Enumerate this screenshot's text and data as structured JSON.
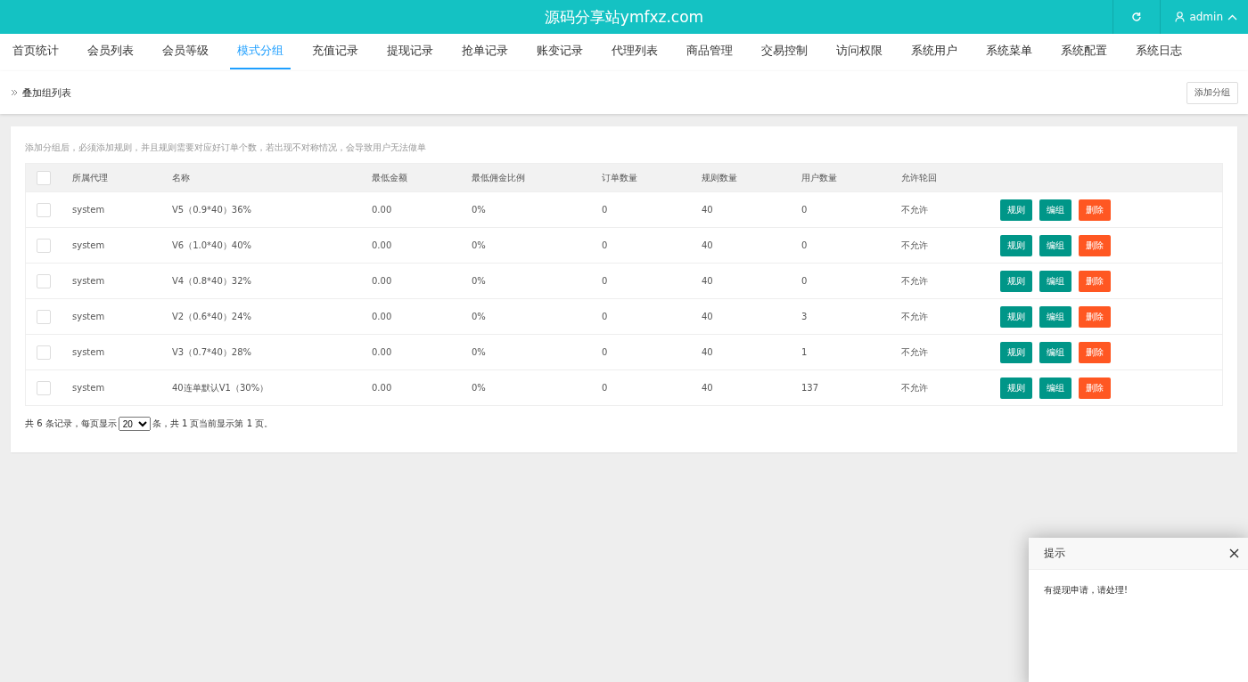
{
  "header": {
    "title": "源码分享站ymfxz.com",
    "user": "admin"
  },
  "tabs": [
    {
      "label": "首页统计",
      "selected": false
    },
    {
      "label": "会员列表",
      "selected": false
    },
    {
      "label": "会员等级",
      "selected": false
    },
    {
      "label": "模式分组",
      "selected": true
    },
    {
      "label": "充值记录",
      "selected": false
    },
    {
      "label": "提现记录",
      "selected": false
    },
    {
      "label": "抢单记录",
      "selected": false
    },
    {
      "label": "账变记录",
      "selected": false
    },
    {
      "label": "代理列表",
      "selected": false
    },
    {
      "label": "商品管理",
      "selected": false
    },
    {
      "label": "交易控制",
      "selected": false
    },
    {
      "label": "访问权限",
      "selected": false
    },
    {
      "label": "系统用户",
      "selected": false
    },
    {
      "label": "系统菜单",
      "selected": false
    },
    {
      "label": "系统配置",
      "selected": false
    },
    {
      "label": "系统日志",
      "selected": false
    }
  ],
  "breadcrumb": "叠加组列表",
  "add_button": "添加分组",
  "notice": "添加分组后，必须添加规则，并且规则需要对应好订单个数，若出现不对称情况，会导致用户无法做单",
  "table": {
    "select_all_checked": false,
    "columns": [
      "所属代理",
      "名称",
      "最低金额",
      "最低佣金比例",
      "订单数量",
      "规则数量",
      "用户数量",
      "允许轮回"
    ],
    "rows": [
      {
        "checked": false,
        "cells": [
          "system",
          "V5（0.9*40）36%",
          "0.00",
          "0%",
          "0",
          "40",
          "0",
          "不允许"
        ],
        "actions": [
          {
            "label": "规则",
            "kind": "primary"
          },
          {
            "label": "编组",
            "kind": "primary"
          },
          {
            "label": "删除",
            "kind": "danger"
          }
        ]
      },
      {
        "checked": false,
        "cells": [
          "system",
          "V6（1.0*40）40%",
          "0.00",
          "0%",
          "0",
          "40",
          "0",
          "不允许"
        ],
        "actions": [
          {
            "label": "规则",
            "kind": "primary"
          },
          {
            "label": "编组",
            "kind": "primary"
          },
          {
            "label": "删除",
            "kind": "danger"
          }
        ]
      },
      {
        "checked": false,
        "cells": [
          "system",
          "V4（0.8*40）32%",
          "0.00",
          "0%",
          "0",
          "40",
          "0",
          "不允许"
        ],
        "actions": [
          {
            "label": "规则",
            "kind": "primary"
          },
          {
            "label": "编组",
            "kind": "primary"
          },
          {
            "label": "删除",
            "kind": "danger"
          }
        ]
      },
      {
        "checked": false,
        "cells": [
          "system",
          "V2（0.6*40）24%",
          "0.00",
          "0%",
          "0",
          "40",
          "3",
          "不允许"
        ],
        "actions": [
          {
            "label": "规则",
            "kind": "primary"
          },
          {
            "label": "编组",
            "kind": "primary"
          },
          {
            "label": "删除",
            "kind": "danger"
          }
        ]
      },
      {
        "checked": false,
        "cells": [
          "system",
          "V3（0.7*40）28%",
          "0.00",
          "0%",
          "0",
          "40",
          "1",
          "不允许"
        ],
        "actions": [
          {
            "label": "规则",
            "kind": "primary"
          },
          {
            "label": "编组",
            "kind": "primary"
          },
          {
            "label": "删除",
            "kind": "danger"
          }
        ]
      },
      {
        "checked": false,
        "cells": [
          "system",
          "40连单默认V1（30%）",
          "0.00",
          "0%",
          "0",
          "40",
          "137",
          "不允许"
        ],
        "actions": [
          {
            "label": "规则",
            "kind": "primary"
          },
          {
            "label": "编组",
            "kind": "primary"
          },
          {
            "label": "删除",
            "kind": "danger"
          }
        ]
      }
    ]
  },
  "pagination": {
    "before": "共 6 条记录，每页显示",
    "page_size": "20",
    "after": "条，共 1 页当前显示第 1 页。"
  },
  "popup": {
    "title": "提示",
    "message": "有提现申请，请处理!"
  }
}
